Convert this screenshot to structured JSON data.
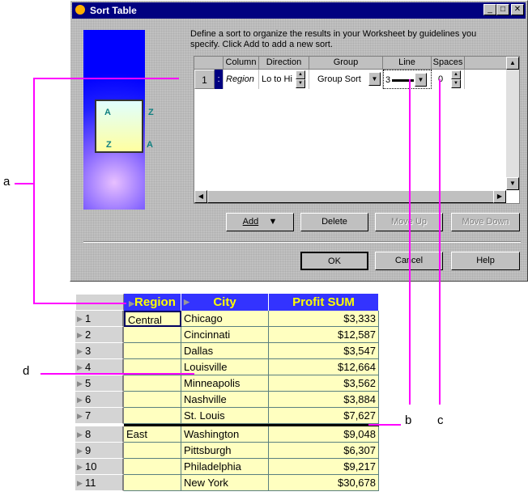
{
  "dialog": {
    "title": "Sort Table",
    "description": "Define a sort to organize the results in your Worksheet by guidelines you specify. Click Add to add a new sort.",
    "grid": {
      "headers": [
        "Column",
        "Direction",
        "Group",
        "Line",
        "Spaces"
      ],
      "row": {
        "num": "1",
        "column": "Region",
        "direction": "Lo to Hi",
        "group": "Group Sort",
        "line": "3",
        "spaces": "0"
      }
    },
    "buttons": {
      "add": "Add",
      "delete": "Delete",
      "move_up": "Move Up",
      "move_down": "Move Down",
      "ok": "OK",
      "cancel": "Cancel",
      "help": "Help"
    },
    "image_letters": [
      "A",
      "Z",
      "Z",
      "A"
    ]
  },
  "table": {
    "headers": [
      "Region",
      "City",
      "Profit SUM"
    ],
    "rows": [
      {
        "n": "1",
        "region": "Central",
        "city": "Chicago",
        "profit": "$3,333"
      },
      {
        "n": "2",
        "region": "",
        "city": "Cincinnati",
        "profit": "$12,587"
      },
      {
        "n": "3",
        "region": "",
        "city": "Dallas",
        "profit": "$3,547"
      },
      {
        "n": "4",
        "region": "",
        "city": "Louisville",
        "profit": "$12,664"
      },
      {
        "n": "5",
        "region": "",
        "city": "Minneapolis",
        "profit": "$3,562"
      },
      {
        "n": "6",
        "region": "",
        "city": "Nashville",
        "profit": "$3,884"
      },
      {
        "n": "7",
        "region": "",
        "city": "St. Louis",
        "profit": "$7,627"
      },
      {
        "n": "8",
        "region": "East",
        "city": "Washington",
        "profit": "$9,048"
      },
      {
        "n": "9",
        "region": "",
        "city": "Pittsburgh",
        "profit": "$6,307"
      },
      {
        "n": "10",
        "region": "",
        "city": "Philadelphia",
        "profit": "$9,217"
      },
      {
        "n": "11",
        "region": "",
        "city": "New York",
        "profit": "$30,678"
      }
    ]
  },
  "callouts": [
    "a",
    "b",
    "c",
    "d"
  ],
  "colors": {
    "header_bg": "#3333ff",
    "header_text": "#ffff00",
    "cell_bg": "#ffffc0",
    "callout": "#ff00ff",
    "titlebar": "#000080"
  }
}
